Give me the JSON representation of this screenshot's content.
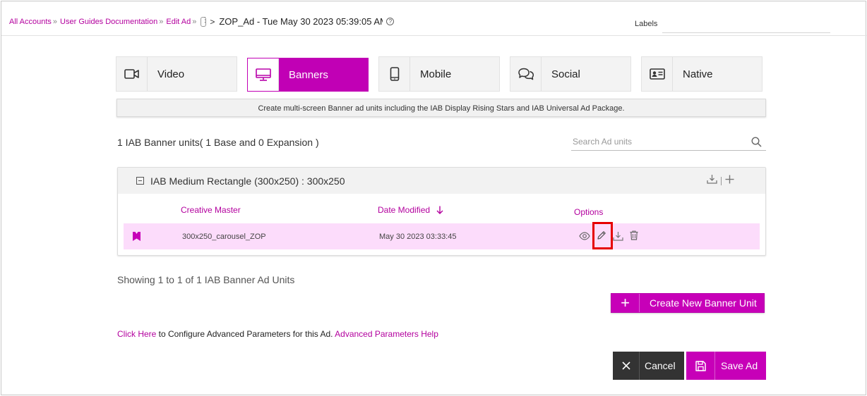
{
  "breadcrumb": {
    "items": [
      "All Accounts",
      "User Guides Documentation",
      "Edit Ad"
    ],
    "separator": "»",
    "current": "ZOP_Ad - Tue May 30 2023 05:39:05 AM"
  },
  "labels": {
    "label": "Labels",
    "value": ""
  },
  "tabs": [
    {
      "label": "Video",
      "icon": "video-camera-icon",
      "active": false
    },
    {
      "label": "Banners",
      "icon": "monitor-icon",
      "active": true
    },
    {
      "label": "Mobile",
      "icon": "mobile-phone-icon",
      "active": false
    },
    {
      "label": "Social",
      "icon": "chat-bubbles-icon",
      "active": false
    },
    {
      "label": "Native",
      "icon": "id-card-icon",
      "active": false
    }
  ],
  "description": "Create multi-screen Banner ad units including the IAB Display Rising Stars and IAB Universal Ad Package.",
  "units_summary": "1 IAB Banner units( 1 Base and 0 Expansion )",
  "search": {
    "placeholder": "Search Ad units",
    "value": ""
  },
  "unit_group": {
    "title": "IAB Medium Rectangle (300x250) : 300x250",
    "columns": {
      "creative_master": "Creative Master",
      "date_modified": "Date Modified",
      "options": "Options"
    },
    "rows": [
      {
        "creative_master": "300x250_carousel_ZOP",
        "date_modified": "May 30 2023 03:33:45"
      }
    ]
  },
  "showing": "Showing 1 to 1 of 1 IAB Banner Ad Units",
  "create_button": {
    "icon": "+",
    "label": "Create New Banner Unit"
  },
  "advanced": {
    "click_here": "Click Here",
    "text": " to Configure Advanced Parameters for this Ad. ",
    "help_link": "Advanced Parameters Help"
  },
  "cancel_button": {
    "label": "Cancel"
  },
  "save_button": {
    "label": "Save Ad"
  },
  "colors": {
    "accent": "#c700b8",
    "link": "#b3009e",
    "row_highlight": "#fcdcfb",
    "dark_button": "#333333",
    "callout": "#e60000"
  }
}
